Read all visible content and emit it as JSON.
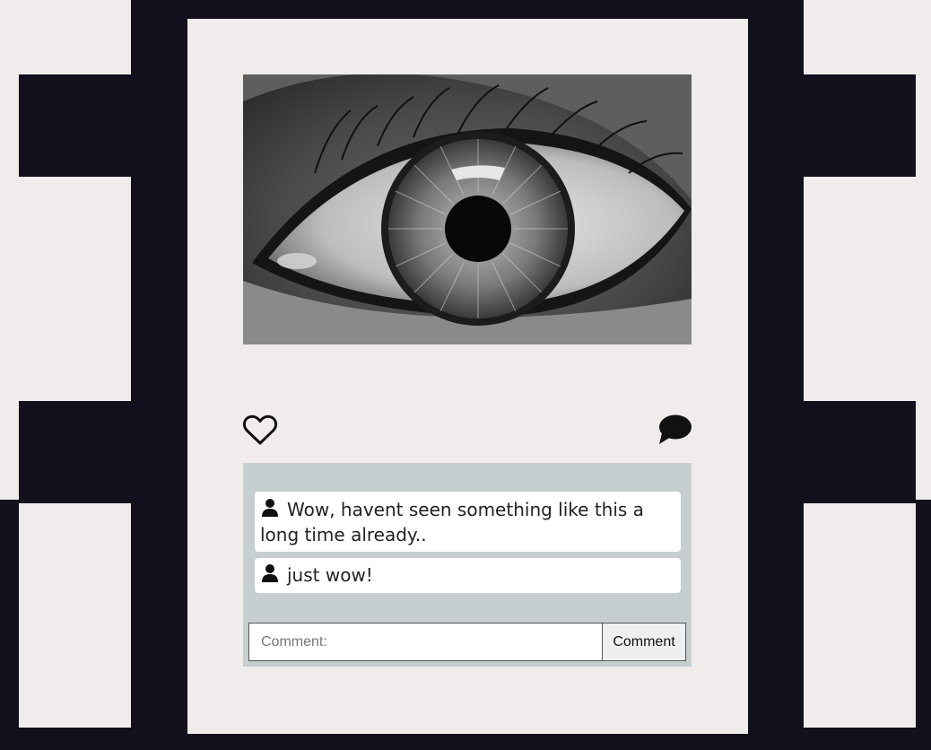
{
  "post": {
    "image": {
      "icon": "eye-photo",
      "alt": ""
    },
    "actions": {
      "like_icon": "heart-outline-icon",
      "comment_icon": "speech-bubble-icon"
    }
  },
  "comments": [
    {
      "user_icon": "user-icon",
      "text": "Wow, havent seen something like this a long time already.."
    },
    {
      "user_icon": "user-icon",
      "text": "just wow!"
    }
  ],
  "comment_form": {
    "placeholder": "Comment:",
    "value": "",
    "button_label": "Comment"
  },
  "colors": {
    "dark": "#11101c",
    "light": "#f0ecec",
    "comments_bg": "#c7ced0",
    "comment_bubble": "#ffffff"
  }
}
